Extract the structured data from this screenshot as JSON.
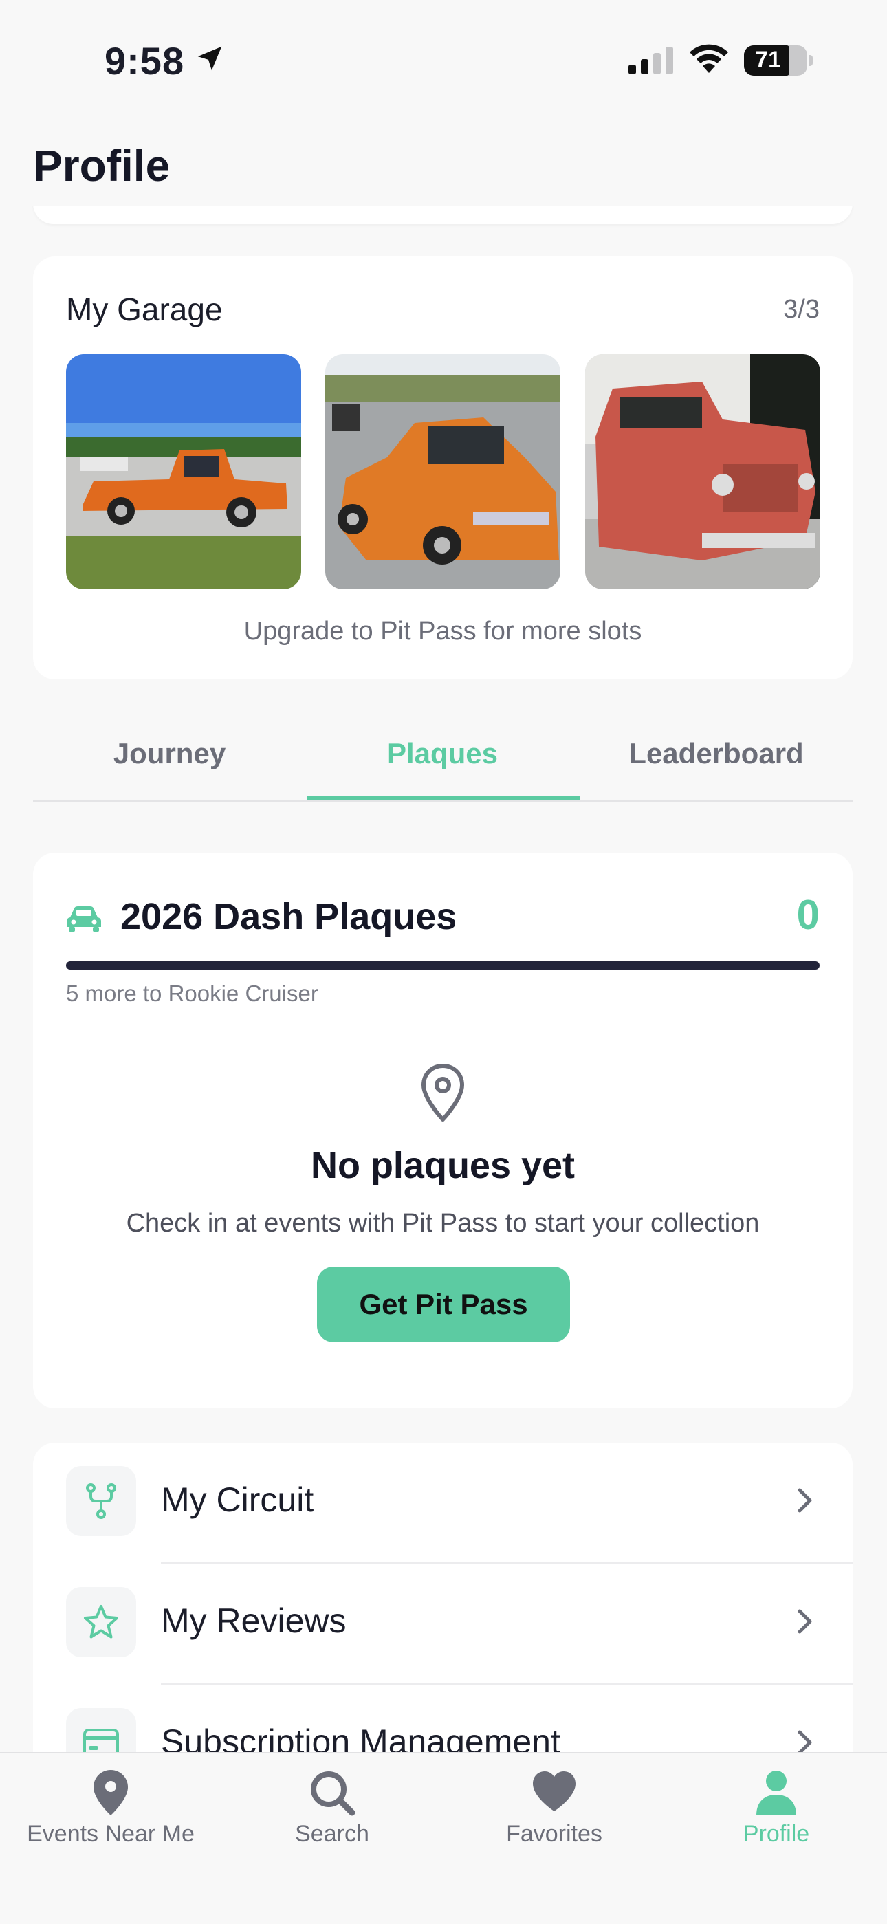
{
  "status_bar": {
    "time": "9:58",
    "battery": "71"
  },
  "header": {
    "title": "Profile"
  },
  "garage": {
    "title": "My Garage",
    "count": "3/3",
    "cars": [
      {
        "alt": "Orange 1950s pickup truck on grass"
      },
      {
        "alt": "Orange GMC pickup truck on highway"
      },
      {
        "alt": "Red rat-rod Dodge pickup truck"
      }
    ],
    "note": "Upgrade to Pit Pass for more slots"
  },
  "tabs": [
    {
      "label": "Journey"
    },
    {
      "label": "Plaques",
      "active": true
    },
    {
      "label": "Leaderboard"
    }
  ],
  "plaques": {
    "title": "2026 Dash Plaques",
    "count": "0",
    "progress_text": "5 more to Rookie Cruiser",
    "empty_title": "No plaques yet",
    "empty_subtitle": "Check in at events with Pit Pass to start your collection",
    "cta_label": "Get Pit Pass"
  },
  "menu": {
    "items": [
      {
        "label": "My Circuit",
        "icon": "circuit-icon"
      },
      {
        "label": "My Reviews",
        "icon": "star-icon"
      },
      {
        "label": "Subscription Management",
        "icon": "credit-card-icon"
      }
    ]
  },
  "tab_bar": {
    "items": [
      {
        "label": "Events Near Me",
        "icon": "map-pin-icon"
      },
      {
        "label": "Search",
        "icon": "search-icon"
      },
      {
        "label": "Favorites",
        "icon": "heart-icon"
      },
      {
        "label": "Profile",
        "icon": "person-icon",
        "active": true
      }
    ]
  },
  "colors": {
    "accent": "#5ccba2",
    "dark": "#151726",
    "muted": "#6b6d78",
    "background": "#f8f8f8"
  }
}
